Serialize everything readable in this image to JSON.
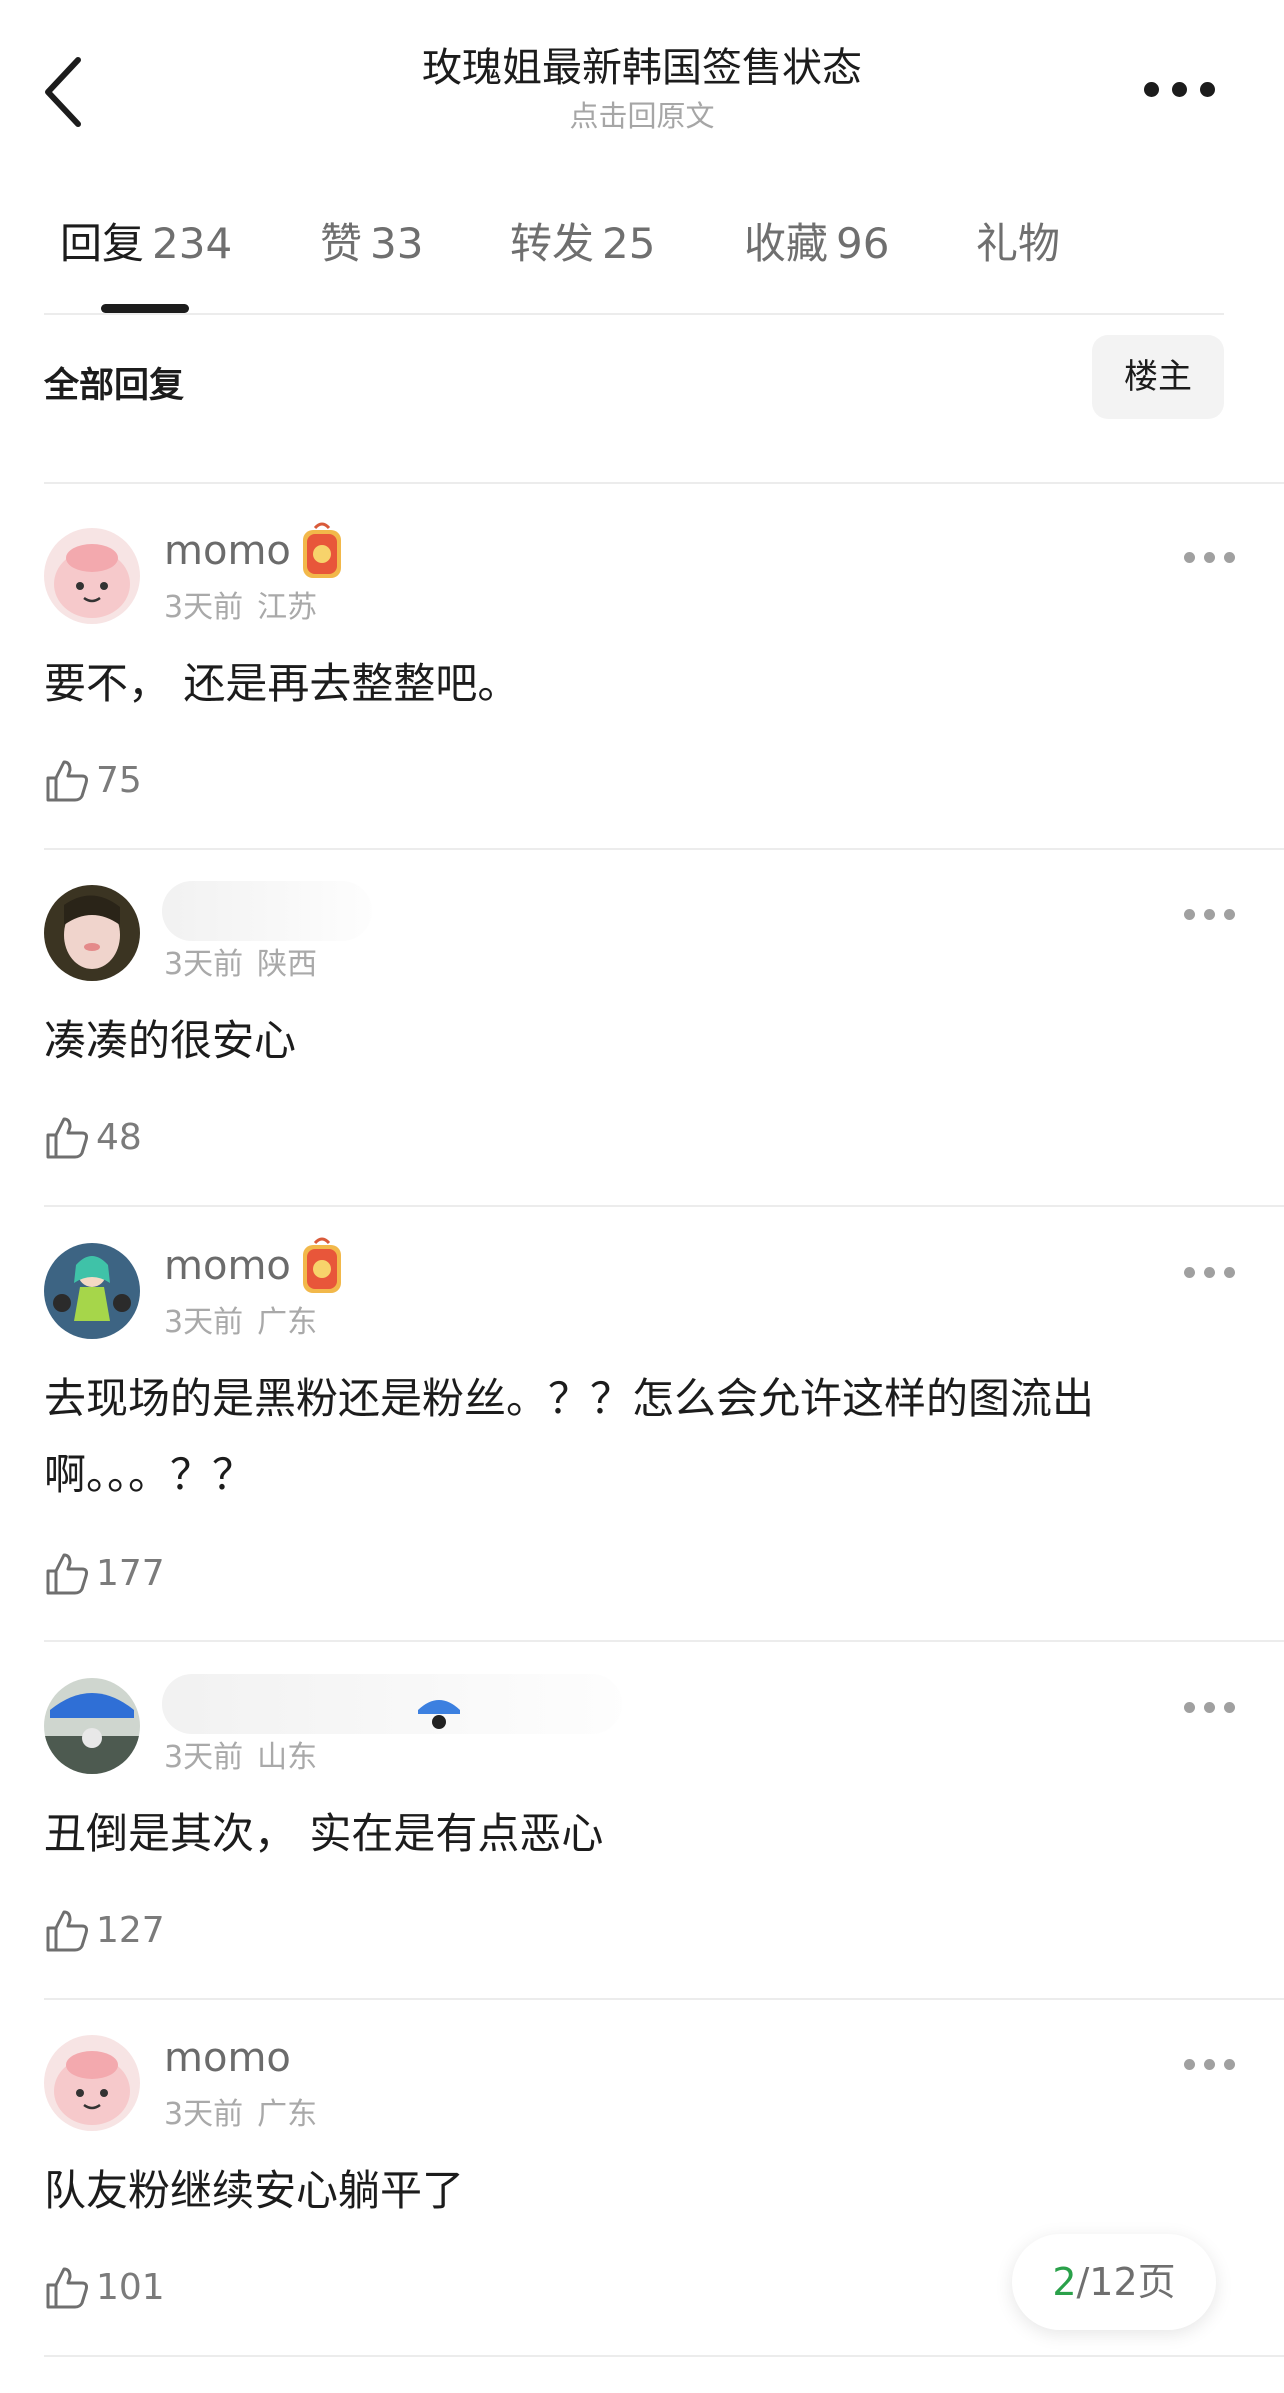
{
  "header": {
    "title": "玫瑰姐最新韩国签售状态",
    "subtitle": "点击回原文"
  },
  "tabs": [
    {
      "label": "回复",
      "count": "234",
      "active": true
    },
    {
      "label": "赞",
      "count": "33"
    },
    {
      "label": "转发",
      "count": "25"
    },
    {
      "label": "收藏",
      "count": "96"
    },
    {
      "label": "礼物",
      "count": ""
    }
  ],
  "filter": {
    "all_label": "全部回复",
    "owner_label": "楼主"
  },
  "comments": [
    {
      "username": "momo",
      "time": "3天前",
      "location": "江苏",
      "text": "要不， 还是再去整整吧。",
      "likes": "75",
      "avatar": "pink-cartoon-avatar",
      "badge": true
    },
    {
      "username": "",
      "time": "3天前",
      "location": "陕西",
      "text": "凑凑的很安心",
      "likes": "48",
      "avatar": "photo-face-avatar",
      "badge": false
    },
    {
      "username": "momo",
      "time": "3天前",
      "location": "广东",
      "text": "去现场的是黑粉还是粉丝。？？怎么会允许这样的图流出啊。。。？？",
      "likes": "177",
      "avatar": "anime-girl-avatar",
      "badge": true
    },
    {
      "username": "",
      "time": "3天前",
      "location": "山东",
      "text": "丑倒是其次，  实在是有点恶心",
      "likes": "127",
      "avatar": "blue-hat-avatar",
      "badge": false
    },
    {
      "username": "momo",
      "time": "3天前",
      "location": "广东",
      "text": "队友粉继续安心躺平了",
      "likes": "101",
      "avatar": "pink-cartoon-avatar",
      "badge": false
    }
  ],
  "pager": {
    "current": "2",
    "total_text": "/12页"
  },
  "colors": {
    "accent_green": "#2aa14a",
    "text_primary": "#1c1c1c",
    "text_secondary": "#a9a9a9"
  }
}
